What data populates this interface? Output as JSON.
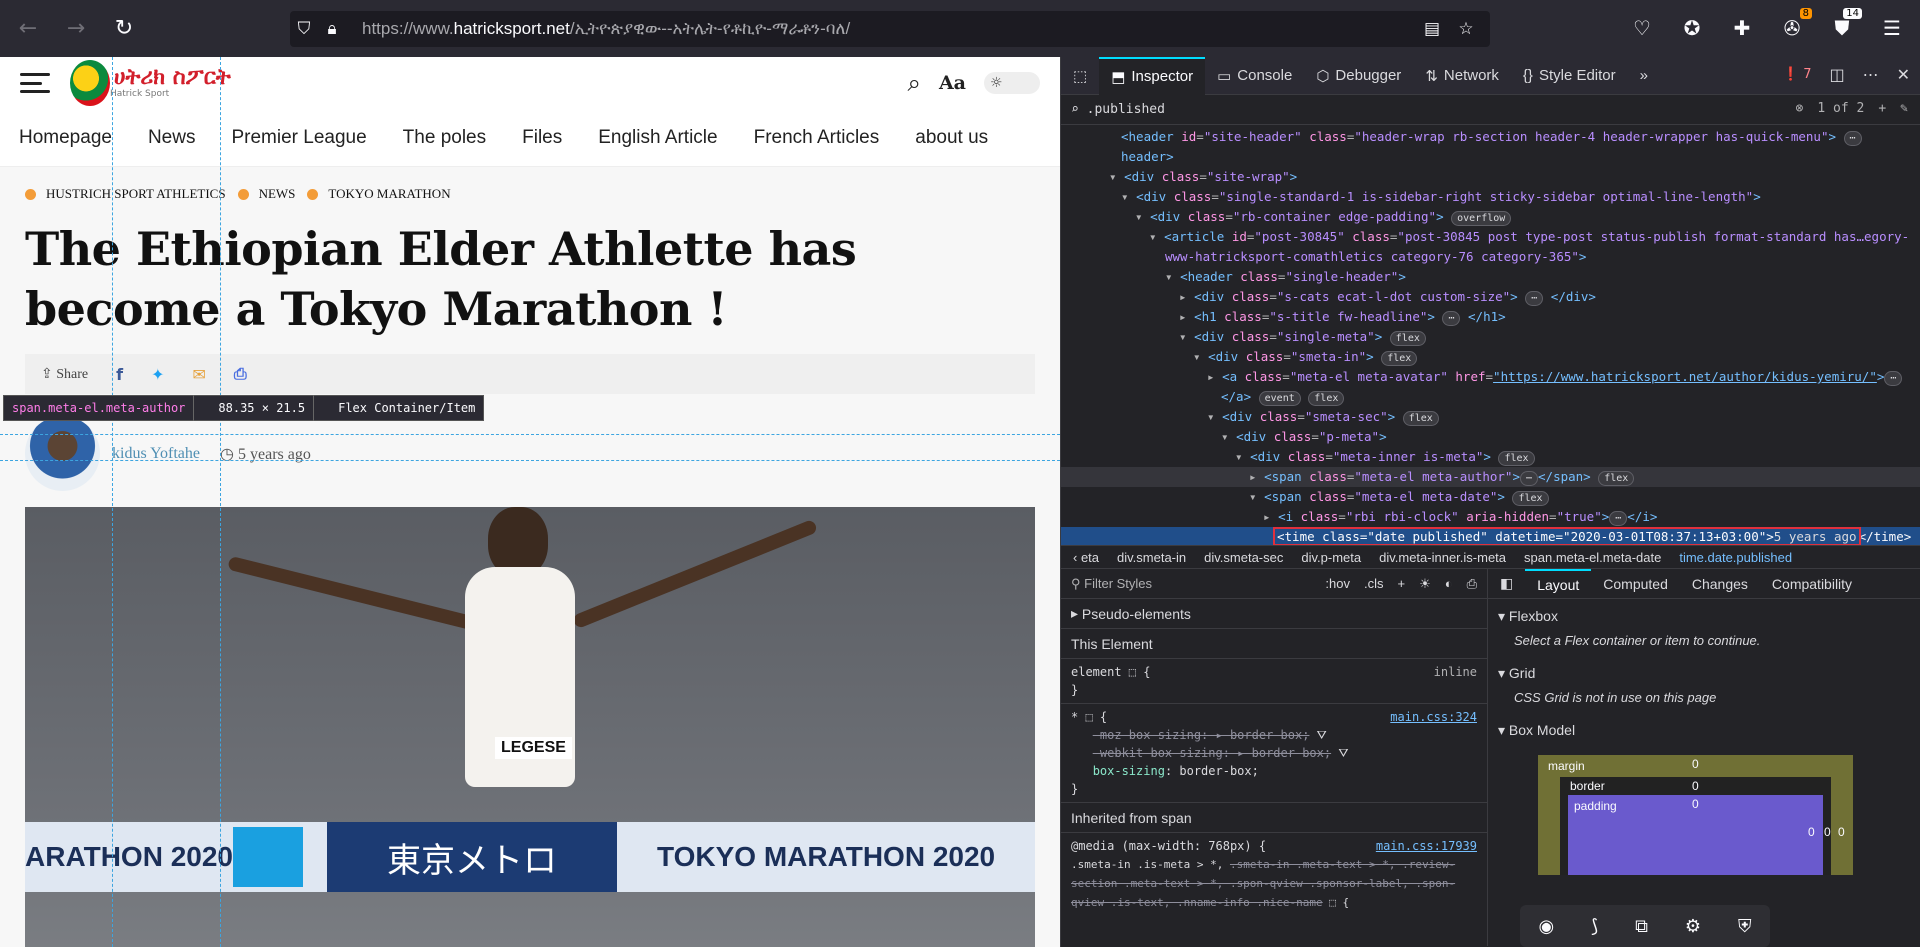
{
  "browser": {
    "url_prefix": "https://www.",
    "url_domain": "hatricksport.net",
    "url_path": "/ኢትዮጵያዊው--አትሌት-የቶኪዮ-ማራቶን-ባለ/",
    "badge_ext1": "8",
    "badge_ext2": "14"
  },
  "site": {
    "logo_text": "ሀትሪክ ስፖርት",
    "logo_sub": "Hatrick Sport",
    "aa_label": "Aa",
    "menu": [
      "Homepage",
      "News",
      "Premier League",
      "The poles",
      "Files",
      "English Article",
      "French Articles",
      "about us"
    ]
  },
  "article": {
    "categories": [
      "HUSTRICH SPORT ATHLETICS",
      "NEWS",
      "TOKYO MARATHON"
    ],
    "headline": "The Ethiopian Elder Athlette has become a Tokyo Marathon !",
    "share_label": "Share",
    "author": "kidus Yoftahe",
    "date": "5 years ago",
    "photo_bib": "LEGESE",
    "photo_banner_left": "ARATHON 2020",
    "photo_banner_box": "東京メトロ",
    "photo_banner_right": "TOKYO MARATHON 2020"
  },
  "tooltip": {
    "name": "span.meta-el.meta-author",
    "size": "88.35 × 21.5",
    "kind": "Flex Container/Item"
  },
  "devtools": {
    "tabs": [
      "Inspector",
      "Console",
      "Debugger",
      "Network",
      "Style Editor"
    ],
    "error_count": "7",
    "search_query": ".published",
    "search_result": "1 of 2",
    "breadcrumbs": [
      "‹ eta",
      "div.smeta-in",
      "div.smeta-sec",
      "div.p-meta",
      "div.meta-inner.is-meta",
      "span.meta-el.meta-date",
      "time.date.published"
    ],
    "filter_placeholder": "Filter Styles",
    "hov": ":hov",
    "cls": ".cls",
    "pseudo": "Pseudo-elements",
    "this_element": "This Element",
    "element_rule": "element",
    "inline": "inline",
    "rule2_src": "main.css:324",
    "inherited": "Inherited from span",
    "rule3_media": "@media (max-width: 768px) {",
    "rule3_src": "main.css:17939",
    "layout_tabs": [
      "Layout",
      "Computed",
      "Changes",
      "Compatibility"
    ],
    "flexbox": "Flexbox",
    "flexbox_msg": "Select a Flex container or item to continue.",
    "grid": "Grid",
    "grid_msg": "CSS Grid is not in use on this page",
    "box_model": "Box Model",
    "bm_margin": "margin",
    "bm_border": "border",
    "bm_padding": "padding",
    "bm_zero": "0"
  }
}
